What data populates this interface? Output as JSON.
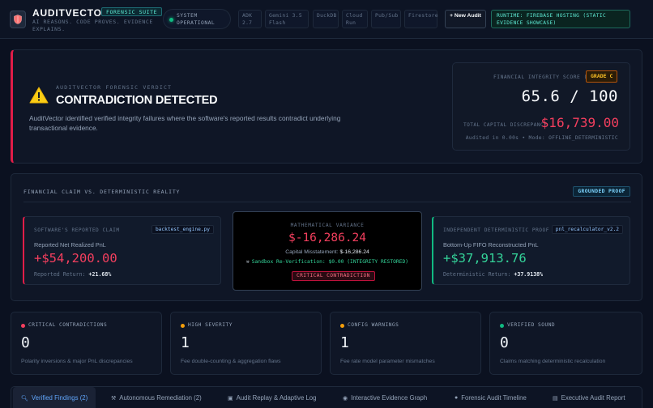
{
  "header": {
    "brand_name": "AUDITVECTOR",
    "brand_badge": "FORENSIC SUITE",
    "tagline": "AI REASONS. CODE PROVES. EVIDENCE EXPLAINS.",
    "status": "SYSTEM OPERATIONAL",
    "tech_chips": [
      "ADK 2.7",
      "Gemini 3.5 Flash",
      "DuckDB",
      "Cloud Run",
      "Pub/Sub",
      "Firestore"
    ],
    "new_audit_label": "+ New Audit",
    "runtime": "RUNTIME: FIREBASE HOSTING (STATIC EVIDENCE SHOWCASE)"
  },
  "verdict": {
    "eyebrow": "AUDITVECTOR FORENSIC VERDICT",
    "title": "CONTRADICTION DETECTED",
    "description": "AuditVector identified verified integrity failures where the software's reported results contradict underlying transactional evidence.",
    "score_label": "FINANCIAL INTEGRITY SCORE (FIS)",
    "grade": "GRADE C",
    "score": "65.6 / 100",
    "discrepancy_label": "TOTAL CAPITAL DISCREPANCY",
    "discrepancy_value": "$16,739.00",
    "audit_meta": "Audited in 0.00s • Mode: OFFLINE_DETERMINISTIC"
  },
  "claim": {
    "title": "FINANCIAL CLAIM VS. DETERMINISTIC REALITY",
    "grounded_badge": "GROUNDED PROOF",
    "reported": {
      "eyebrow": "SOFTWARE'S REPORTED CLAIM",
      "file": "backtest_engine.py",
      "label": "Reported Net Realized PnL",
      "value": "+$54,200.00",
      "foot_label": "Reported Return:",
      "foot_value": "+21.68%"
    },
    "variance": {
      "eyebrow": "MATHEMATICAL VARIANCE",
      "value": "$-16,286.24",
      "misstatement_label": "Capital Misstatement:",
      "misstatement_value": "$-16,286.24",
      "sandbox": "Sandbox Re-Verification: $0.00 (INTEGRITY RESTORED)",
      "badge": "CRITICAL CONTRADICTION"
    },
    "independent": {
      "eyebrow": "INDEPENDENT DETERMINISTIC PROOF",
      "file": "pnl_recalculator_v2.2",
      "label": "Bottom-Up FIFO Reconstructed PnL",
      "value": "+$37,913.76",
      "foot_label": "Deterministic Return:",
      "foot_value": "+37.9138%"
    }
  },
  "stats": [
    {
      "label": "CRITICAL CONTRADICTIONS",
      "value": "0",
      "desc": "Polarity inversions & major PnL discrepancies",
      "color": "#f43f5e"
    },
    {
      "label": "HIGH SEVERITY",
      "value": "1",
      "desc": "Fee double-counting & aggregation flaws",
      "color": "#f59e0b"
    },
    {
      "label": "CONFIG WARNINGS",
      "value": "1",
      "desc": "Fee rate model parameter mismatches",
      "color": "#f59e0b"
    },
    {
      "label": "VERIFIED SOUND",
      "value": "0",
      "desc": "Claims matching deterministic recalculation",
      "color": "#10b981"
    }
  ],
  "tabs": [
    {
      "label": "Verified Findings (2)",
      "icon": "magnifier-icon"
    },
    {
      "label": "Autonomous Remediation (2)",
      "icon": "hammer-icon"
    },
    {
      "label": "Audit Replay & Adaptive Log",
      "icon": "replay-icon"
    },
    {
      "label": "Interactive Evidence Graph",
      "icon": "graph-icon"
    },
    {
      "label": "Forensic Audit Timeline",
      "icon": "clock-icon"
    },
    {
      "label": "Executive Audit Report",
      "icon": "document-icon"
    }
  ],
  "colors": {
    "background": "#0b1120",
    "accent_red": "#f43f5e",
    "accent_green": "#34d399",
    "accent_amber": "#f59e0b",
    "accent_blue": "#60a5fa"
  }
}
